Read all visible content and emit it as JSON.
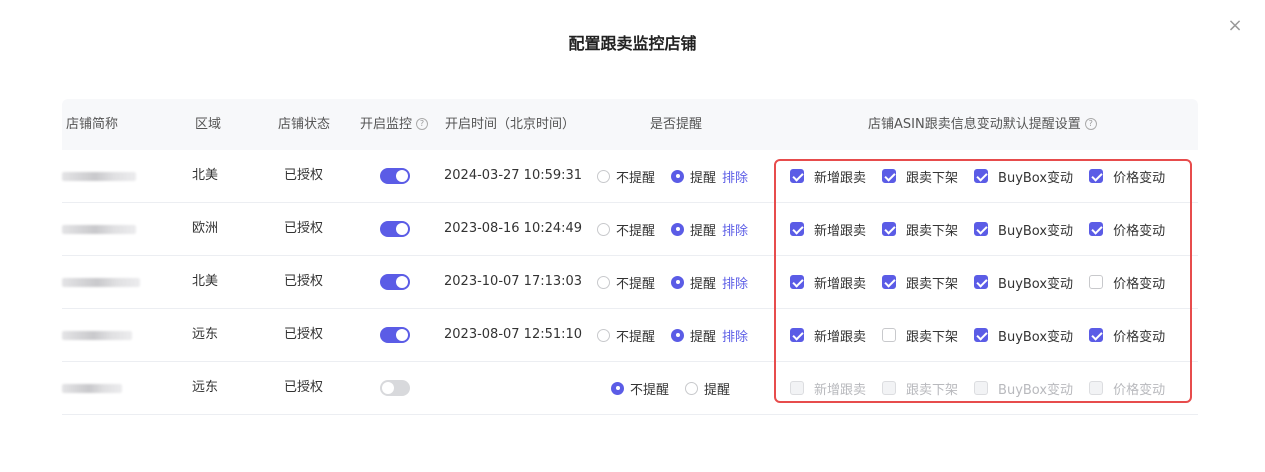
{
  "dialog": {
    "title": "配置跟卖监控店铺",
    "close_glyph": "×"
  },
  "headers": {
    "store": "店铺简称",
    "region": "区域",
    "status": "店铺状态",
    "monitor": "开启监控",
    "time": "开启时间（北京时间）",
    "remind": "是否提醒",
    "settings": "店铺ASIN跟卖信息变动默认提醒设置"
  },
  "labels": {
    "no_remind": "不提醒",
    "remind": "提醒",
    "exclude": "排除",
    "check_new": "新增跟卖",
    "check_off": "跟卖下架",
    "check_buybox": "BuyBox变动",
    "check_price": "价格变动"
  },
  "rows": [
    {
      "region": "北美",
      "status": "已授权",
      "monitor": true,
      "time": "2024-03-27 10:59:31",
      "remind": true,
      "checks": [
        true,
        true,
        true,
        true
      ],
      "disabled": false
    },
    {
      "region": "欧洲",
      "status": "已授权",
      "monitor": true,
      "time": "2023-08-16 10:24:49",
      "remind": true,
      "checks": [
        true,
        true,
        true,
        true
      ],
      "disabled": false
    },
    {
      "region": "北美",
      "status": "已授权",
      "monitor": true,
      "time": "2023-10-07 17:13:03",
      "remind": true,
      "checks": [
        true,
        true,
        true,
        false
      ],
      "disabled": false
    },
    {
      "region": "远东",
      "status": "已授权",
      "monitor": true,
      "time": "2023-08-07 12:51:10",
      "remind": true,
      "checks": [
        true,
        false,
        true,
        true
      ],
      "disabled": false
    },
    {
      "region": "远东",
      "status": "已授权",
      "monitor": false,
      "time": "",
      "remind": false,
      "checks": [
        false,
        false,
        false,
        false
      ],
      "disabled": true
    }
  ],
  "colors": {
    "accent": "#5b5ce6",
    "highlight_border": "#e74c4c"
  }
}
